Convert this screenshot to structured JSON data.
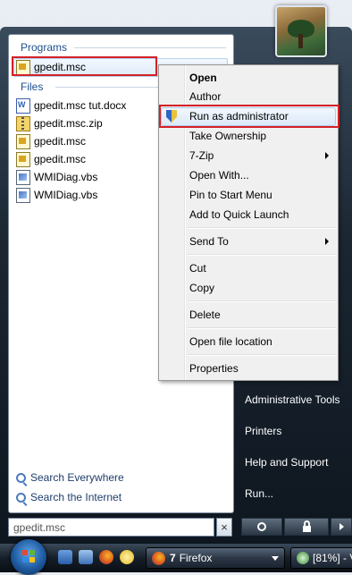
{
  "start_menu": {
    "programs_header": "Programs",
    "files_header": "Files",
    "programs": [
      {
        "label": "gpedit.msc",
        "icon": "msc-icon"
      }
    ],
    "files": [
      {
        "label": "gpedit.msc tut.docx",
        "icon": "word-doc-icon"
      },
      {
        "label": "gpedit.msc.zip",
        "icon": "zip-icon"
      },
      {
        "label": "gpedit.msc",
        "icon": "msc-icon"
      },
      {
        "label": "gpedit.msc",
        "icon": "msc-icon"
      },
      {
        "label": "WMIDiag.vbs",
        "icon": "vbs-script-icon"
      },
      {
        "label": "WMIDiag.vbs",
        "icon": "vbs-script-icon"
      }
    ],
    "search_everywhere": "Search Everywhere",
    "search_internet": "Search the Internet",
    "search_value": "gpedit.msc",
    "right_links": [
      "Administrative Tools",
      "Printers",
      "Help and Support",
      "Run..."
    ]
  },
  "context_menu": {
    "items": {
      "open": "Open",
      "author": "Author",
      "run_as_admin": "Run as administrator",
      "take_ownership": "Take Ownership",
      "seven_zip": "7-Zip",
      "open_with": "Open With...",
      "pin_start": "Pin to Start Menu",
      "add_quick_launch": "Add to Quick Launch",
      "send_to": "Send To",
      "cut": "Cut",
      "copy": "Copy",
      "delete": "Delete",
      "open_file_location": "Open file location",
      "properties": "Properties"
    },
    "highlighted": "Run as administrator"
  },
  "taskbar": {
    "firefox_count": "7",
    "firefox_label": "Firefox",
    "second_task": "[81%] - V"
  },
  "colors": {
    "highlight_box": "#d42126",
    "link_blue": "#1e4f8f",
    "menu_bg": "#f0f0f0"
  }
}
